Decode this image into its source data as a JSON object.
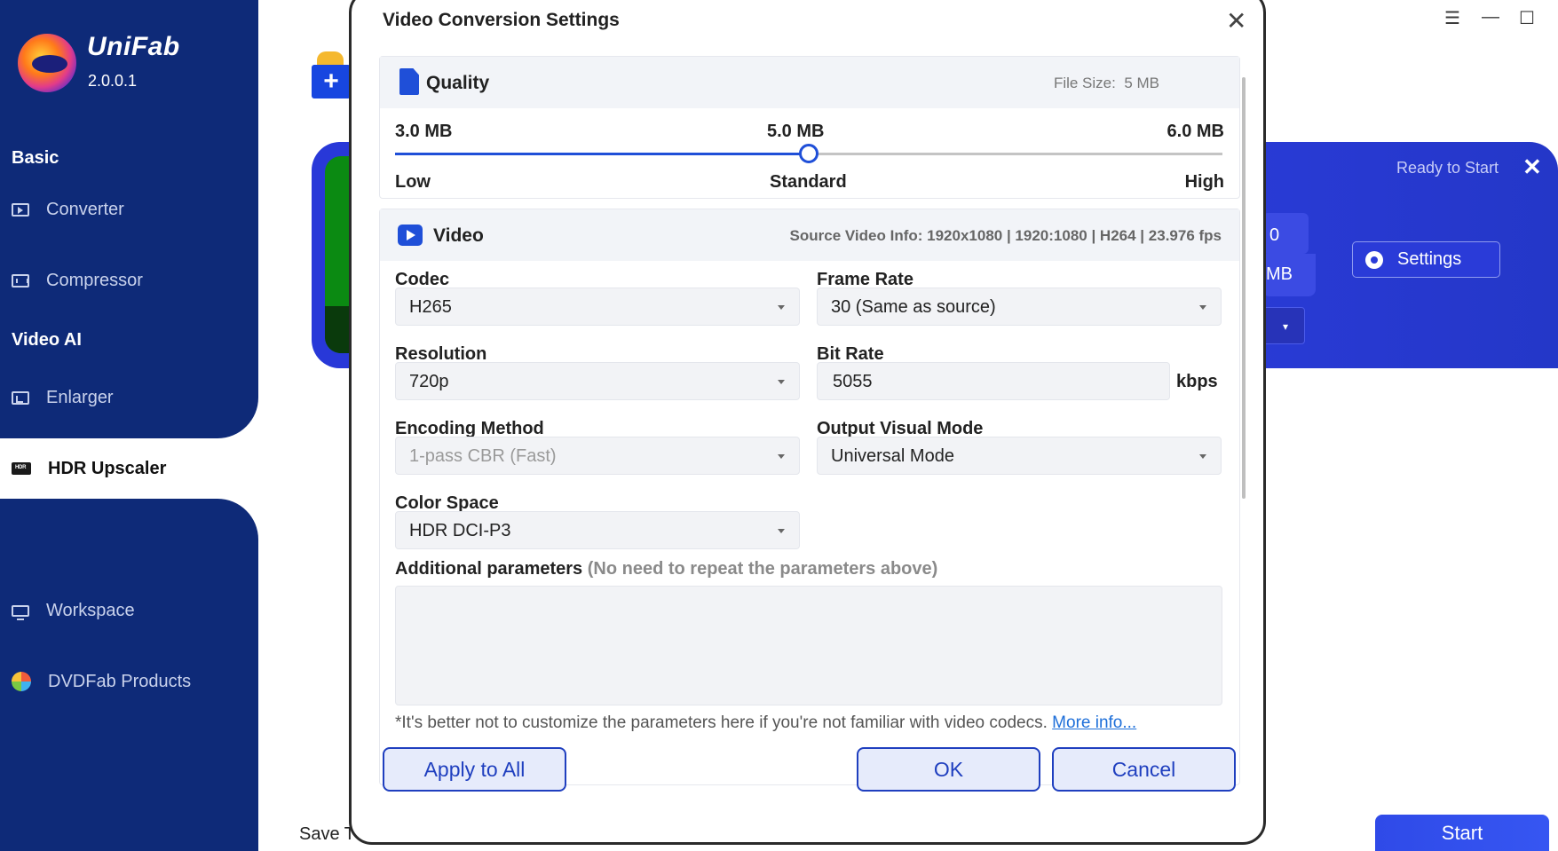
{
  "app": {
    "brand": "UniFab",
    "version": "2.0.0.1"
  },
  "sidebar": {
    "sections": {
      "basic": "Basic",
      "video_ai": "Video AI"
    },
    "items": {
      "converter": "Converter",
      "compressor": "Compressor",
      "enlarger": "Enlarger",
      "hdr_upscaler": "HDR Upscaler",
      "workspace": "Workspace",
      "dvdfab_products": "DVDFab Products"
    },
    "hdr_tag": "HDR"
  },
  "main": {
    "add_label": "+",
    "task": {
      "status": "Ready to Start",
      "close": "✕",
      "partial_value": "0",
      "partial_unit": "MB",
      "settings_label": "Settings"
    },
    "save_label": "Save T",
    "start_label": "Start"
  },
  "window_controls": {
    "menu": "☰",
    "minimize": "—",
    "maximize": "☐"
  },
  "dialog": {
    "title": "Video Conversion Settings",
    "close": "✕",
    "quality": {
      "title": "Quality",
      "file_size_label": "File Size:",
      "file_size_value": "5 MB",
      "size_min": "3.0 MB",
      "size_mid": "5.0 MB",
      "size_max": "6.0 MB",
      "level_low": "Low",
      "level_mid": "Standard",
      "level_high": "High",
      "slider_value_mb": 5.0,
      "slider_min_mb": 3.0,
      "slider_max_mb": 6.0
    },
    "video": {
      "title": "Video",
      "source_info": "Source Video Info: 1920x1080 | 1920:1080 | H264 | 23.976 fps",
      "codec_label": "Codec",
      "codec_value": "H265",
      "frame_rate_label": "Frame Rate",
      "frame_rate_value": "30 (Same as source)",
      "resolution_label": "Resolution",
      "resolution_value": "720p",
      "bit_rate_label": "Bit Rate",
      "bit_rate_value": "5055",
      "bit_rate_unit": "kbps",
      "encoding_label": "Encoding Method",
      "encoding_value": "1-pass CBR (Fast)",
      "visual_mode_label": "Output Visual Mode",
      "visual_mode_value": "Universal Mode",
      "color_space_label": "Color Space",
      "color_space_value": "HDR DCI-P3",
      "additional_label": "Additional parameters",
      "additional_hint": "(No need to repeat the parameters above)",
      "note": "*It's better not to customize the parameters here if you're not familiar with video codecs.",
      "more_info": "More info..."
    },
    "buttons": {
      "apply_all": "Apply to All",
      "ok": "OK",
      "cancel": "Cancel"
    }
  },
  "colors": {
    "sidebar": "#0e2a78",
    "accent": "#1f4fd8",
    "task_panel": "#2838d8",
    "link": "#1e6fd9"
  }
}
